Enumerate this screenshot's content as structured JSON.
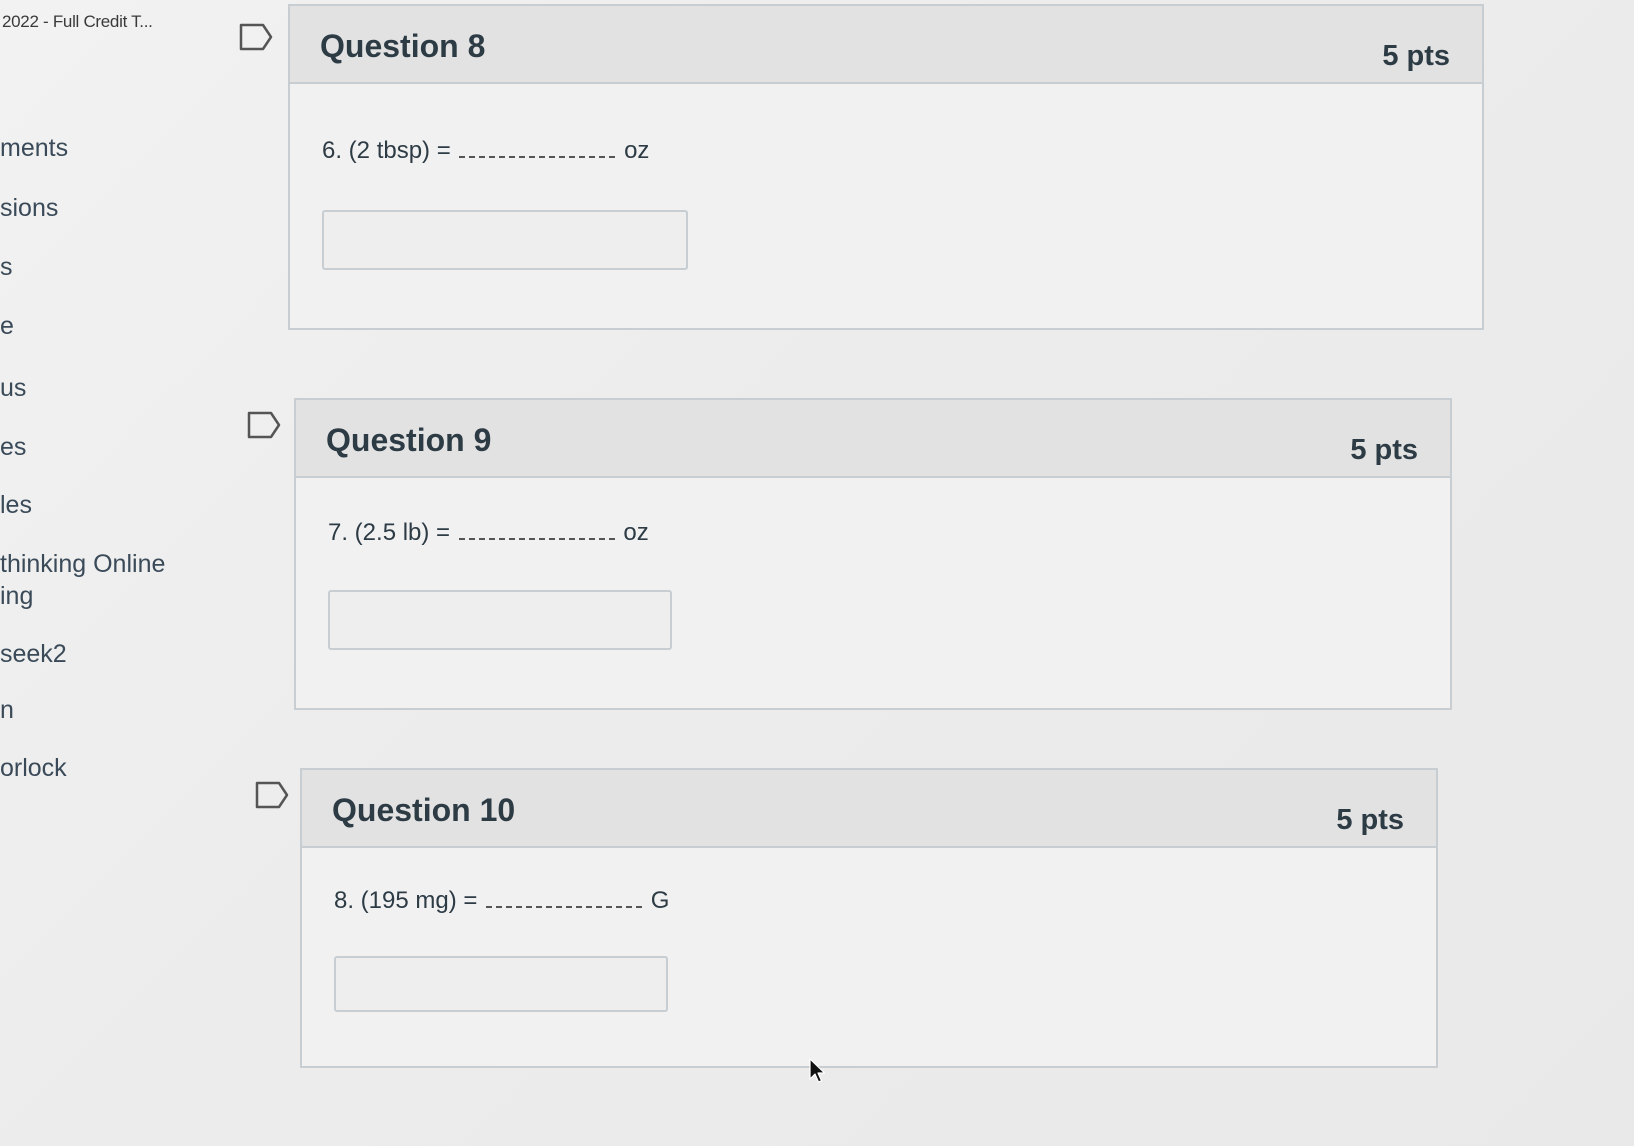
{
  "sidebar": {
    "course_title": "2022 - Full Credit T...",
    "items": [
      {
        "label": "ments"
      },
      {
        "label": "sions"
      },
      {
        "label": "s"
      },
      {
        "label": "e"
      },
      {
        "label": "us"
      },
      {
        "label": "es"
      },
      {
        "label": "les"
      },
      {
        "label": "thinking Online"
      },
      {
        "label": "ing"
      },
      {
        "label": "seek2"
      },
      {
        "label": "n"
      },
      {
        "label": "orlock"
      }
    ]
  },
  "questions": [
    {
      "title": "Question 8",
      "points": "5 pts",
      "prompt": "6. (2 tbsp) =",
      "unit": "oz",
      "answer_value": "",
      "answer_placeholder": ""
    },
    {
      "title": "Question 9",
      "points": "5 pts",
      "prompt": "7. (2.5 lb) =",
      "unit": "oz",
      "answer_value": "",
      "answer_placeholder": ""
    },
    {
      "title": "Question 10",
      "points": "5 pts",
      "prompt": "8. (195 mg) =",
      "unit": "G",
      "answer_value": "",
      "answer_placeholder": ""
    }
  ],
  "icons": {
    "flag": "flag-icon",
    "cursor": "mouse-cursor-icon"
  },
  "colors": {
    "header_bg": "#e2e2e2",
    "border": "#c7cdd1",
    "text": "#2d3b45"
  }
}
